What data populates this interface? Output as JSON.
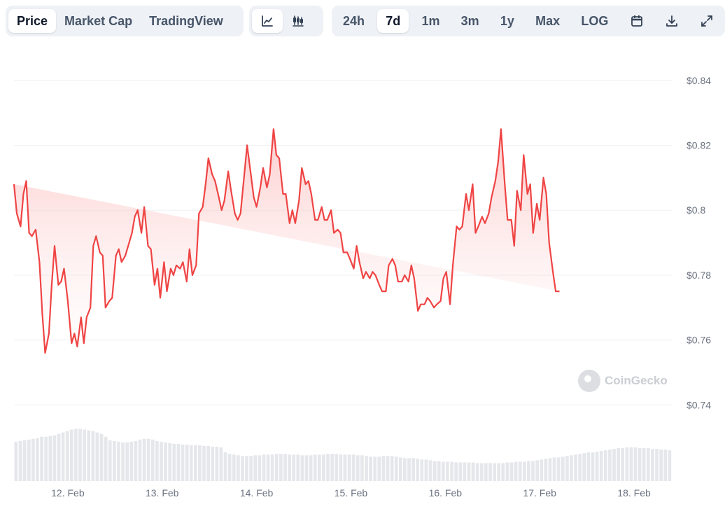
{
  "toolbar": {
    "chart_type_tabs": [
      "Price",
      "Market Cap",
      "TradingView"
    ],
    "active_chart_type": "Price",
    "view_icons": [
      "line-chart-icon",
      "candlestick-chart-icon"
    ],
    "active_view": "line-chart-icon",
    "ranges": [
      "24h",
      "7d",
      "1m",
      "3m",
      "1y",
      "Max"
    ],
    "active_range": "7d",
    "log_label": "LOG",
    "tool_icons": [
      "calendar-icon",
      "download-icon",
      "expand-icon"
    ]
  },
  "watermark": "CoinGecko",
  "colors": {
    "line": "#ef4444",
    "area_top": "#fecaca",
    "volume": "#e5e7eb",
    "grid": "#eef0f3"
  },
  "chart_data": {
    "type": "area",
    "currency_prefix": "$",
    "y_ticks": [
      "$0.84",
      "$0.82",
      "$0.8",
      "$0.78",
      "$0.76",
      "$0.74"
    ],
    "y_tick_values": [
      0.84,
      0.82,
      0.8,
      0.78,
      0.76,
      0.74
    ],
    "ylim": [
      0.7375,
      0.8475
    ],
    "x_ticks": [
      "12. Feb",
      "13. Feb",
      "14. Feb",
      "15. Feb",
      "16. Feb",
      "17. Feb",
      "18. Feb"
    ],
    "x_tick_days": [
      1,
      2,
      3,
      4,
      5,
      6,
      7
    ],
    "xlim_days": [
      0.43,
      7.4
    ],
    "grid": true,
    "price_series": {
      "days": [
        0.43,
        0.46,
        0.5,
        0.53,
        0.56,
        0.59,
        0.62,
        0.66,
        0.7,
        0.73,
        0.76,
        0.8,
        0.83,
        0.86,
        0.9,
        0.93,
        0.96,
        1.0,
        1.04,
        1.07,
        1.1,
        1.14,
        1.17,
        1.2,
        1.24,
        1.27,
        1.3,
        1.34,
        1.37,
        1.4,
        1.44,
        1.47,
        1.51,
        1.54,
        1.57,
        1.61,
        1.64,
        1.68,
        1.71,
        1.74,
        1.78,
        1.81,
        1.85,
        1.88,
        1.92,
        1.95,
        1.98,
        2.02,
        2.05,
        2.09,
        2.12,
        2.15,
        2.19,
        2.22,
        2.26,
        2.29,
        2.32,
        2.36,
        2.39,
        2.43,
        2.46,
        2.49,
        2.53,
        2.56,
        2.6,
        2.63,
        2.66,
        2.7,
        2.73,
        2.77,
        2.8,
        2.83,
        2.87,
        2.9,
        2.94,
        2.97,
        3.0,
        3.04,
        3.07,
        3.11,
        3.14,
        3.18,
        3.21,
        3.24,
        3.28,
        3.31,
        3.35,
        3.38,
        3.41,
        3.45,
        3.48,
        3.52,
        3.55,
        3.58,
        3.62,
        3.65,
        3.69,
        3.72,
        3.75,
        3.79,
        3.82,
        3.86,
        3.89,
        3.92,
        3.96,
        3.99,
        4.03,
        4.06,
        4.09,
        4.13,
        4.16,
        4.2,
        4.23,
        4.26,
        4.3,
        4.33,
        4.37,
        4.4,
        4.44,
        4.47,
        4.5,
        4.54,
        4.57,
        4.61,
        4.64,
        4.67,
        4.71,
        4.74,
        4.78,
        4.81,
        4.84,
        4.88,
        4.91,
        4.95,
        4.98,
        5.01,
        5.05,
        5.08,
        5.12,
        5.15,
        5.18,
        5.22,
        5.25,
        5.29,
        5.32,
        5.35,
        5.39,
        5.42,
        5.46,
        5.49,
        5.53,
        5.56,
        5.59,
        5.63,
        5.66,
        5.7,
        5.73,
        5.76,
        5.8,
        5.83,
        5.87,
        5.9,
        5.93,
        5.97,
        6.0,
        6.04,
        6.07,
        6.1,
        6.14,
        6.17,
        6.21,
        6.24,
        6.27,
        6.31,
        6.34,
        6.38,
        6.41,
        6.45,
        6.48,
        6.51,
        6.55,
        6.58,
        6.62,
        6.65,
        6.68,
        6.72,
        6.75,
        6.79,
        6.82,
        6.85,
        6.89,
        6.92,
        6.96,
        6.99,
        7.02,
        7.06,
        7.09,
        7.13,
        7.16,
        7.19,
        7.23,
        7.26,
        7.3,
        7.33,
        7.36,
        7.4
      ],
      "values": [
        0.808,
        0.799,
        0.795,
        0.805,
        0.809,
        0.793,
        0.792,
        0.794,
        0.784,
        0.768,
        0.756,
        0.762,
        0.777,
        0.789,
        0.777,
        0.778,
        0.782,
        0.772,
        0.759,
        0.762,
        0.758,
        0.767,
        0.759,
        0.767,
        0.77,
        0.789,
        0.792,
        0.787,
        0.786,
        0.77,
        0.772,
        0.773,
        0.786,
        0.788,
        0.784,
        0.786,
        0.789,
        0.793,
        0.798,
        0.8,
        0.793,
        0.801,
        0.789,
        0.788,
        0.777,
        0.782,
        0.773,
        0.784,
        0.775,
        0.782,
        0.78,
        0.783,
        0.782,
        0.784,
        0.778,
        0.788,
        0.78,
        0.783,
        0.799,
        0.801,
        0.808,
        0.816,
        0.811,
        0.809,
        0.804,
        0.8,
        0.803,
        0.812,
        0.806,
        0.799,
        0.797,
        0.799,
        0.811,
        0.82,
        0.811,
        0.804,
        0.801,
        0.807,
        0.813,
        0.807,
        0.811,
        0.825,
        0.817,
        0.816,
        0.805,
        0.805,
        0.796,
        0.8,
        0.796,
        0.803,
        0.813,
        0.808,
        0.809,
        0.805,
        0.797,
        0.797,
        0.801,
        0.797,
        0.797,
        0.8,
        0.793,
        0.794,
        0.793,
        0.787,
        0.787,
        0.785,
        0.782,
        0.789,
        0.784,
        0.779,
        0.781,
        0.779,
        0.781,
        0.78,
        0.777,
        0.775,
        0.775,
        0.783,
        0.785,
        0.783,
        0.778,
        0.778,
        0.78,
        0.778,
        0.783,
        0.779,
        0.769,
        0.771,
        0.771,
        0.773,
        0.772,
        0.77,
        0.771,
        0.772,
        0.779,
        0.781,
        0.771,
        0.783,
        0.795,
        0.794,
        0.795,
        0.805,
        0.8,
        0.808,
        0.793,
        0.795,
        0.798,
        0.796,
        0.799,
        0.804,
        0.809,
        0.815,
        0.825,
        0.808,
        0.797,
        0.797,
        0.789,
        0.806,
        0.8,
        0.817,
        0.805,
        0.808,
        0.793,
        0.802,
        0.797,
        0.81,
        0.805,
        0.79,
        0.781,
        0.775,
        0.775
      ],
      "name": ""
    },
    "volume_series": {
      "note_units": "relative",
      "values": [
        0.55,
        0.56,
        0.57,
        0.58,
        0.59,
        0.6,
        0.62,
        0.62,
        0.63,
        0.64,
        0.66,
        0.68,
        0.7,
        0.72,
        0.73,
        0.73,
        0.72,
        0.71,
        0.7,
        0.68,
        0.66,
        0.62,
        0.57,
        0.56,
        0.55,
        0.54,
        0.54,
        0.55,
        0.56,
        0.58,
        0.59,
        0.59,
        0.58,
        0.56,
        0.55,
        0.54,
        0.53,
        0.52,
        0.52,
        0.51,
        0.51,
        0.5,
        0.5,
        0.5,
        0.49,
        0.49,
        0.48,
        0.48,
        0.47,
        0.4,
        0.38,
        0.37,
        0.36,
        0.35,
        0.35,
        0.35,
        0.36,
        0.36,
        0.37,
        0.37,
        0.37,
        0.38,
        0.38,
        0.38,
        0.37,
        0.37,
        0.37,
        0.36,
        0.36,
        0.36,
        0.37,
        0.37,
        0.37,
        0.38,
        0.38,
        0.38,
        0.37,
        0.37,
        0.37,
        0.37,
        0.36,
        0.36,
        0.35,
        0.34,
        0.34,
        0.34,
        0.35,
        0.35,
        0.35,
        0.34,
        0.33,
        0.32,
        0.32,
        0.32,
        0.31,
        0.3,
        0.3,
        0.29,
        0.28,
        0.28,
        0.27,
        0.27,
        0.27,
        0.26,
        0.26,
        0.26,
        0.26,
        0.26,
        0.25,
        0.25,
        0.25,
        0.25,
        0.25,
        0.25,
        0.25,
        0.26,
        0.26,
        0.27,
        0.27,
        0.27,
        0.28,
        0.28,
        0.29,
        0.3,
        0.31,
        0.32,
        0.33,
        0.33,
        0.34,
        0.35,
        0.36,
        0.37,
        0.38,
        0.39,
        0.4,
        0.4,
        0.41,
        0.42,
        0.43,
        0.44,
        0.45,
        0.46,
        0.46,
        0.47,
        0.47,
        0.47,
        0.46,
        0.46,
        0.46,
        0.45,
        0.45,
        0.44,
        0.44,
        0.43
      ]
    }
  }
}
